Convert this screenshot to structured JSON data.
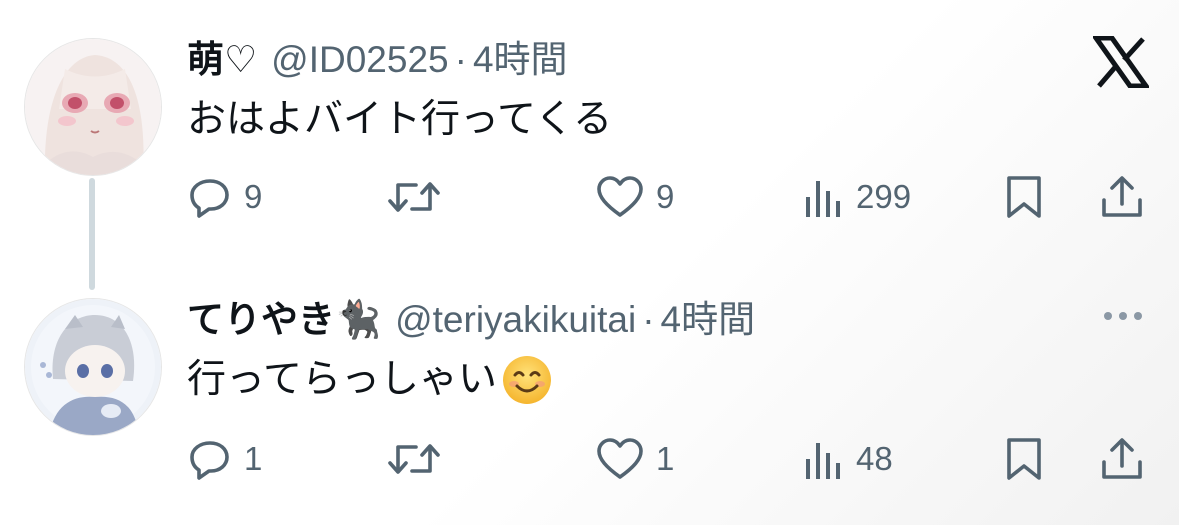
{
  "brand": {
    "logo_icon": "x-logo-icon"
  },
  "colors": {
    "text": "#0f1419",
    "muted": "#536471",
    "thread_line": "#cfd9de"
  },
  "tweets": [
    {
      "display_name": "萌♡",
      "handle": "@ID02525",
      "separator": "·",
      "time": "4時間",
      "text": "おはよバイト行ってくる",
      "replies": "9",
      "retweets": "",
      "likes": "9",
      "views": "299"
    },
    {
      "display_name": "てりやき🐈‍⬛",
      "handle": "@teriyakikuitai",
      "separator": "·",
      "time": "4時間",
      "text": "行ってらっしゃい",
      "emoji": "smiling-face-emoji",
      "replies": "1",
      "retweets": "",
      "likes": "1",
      "views": "48"
    }
  ]
}
